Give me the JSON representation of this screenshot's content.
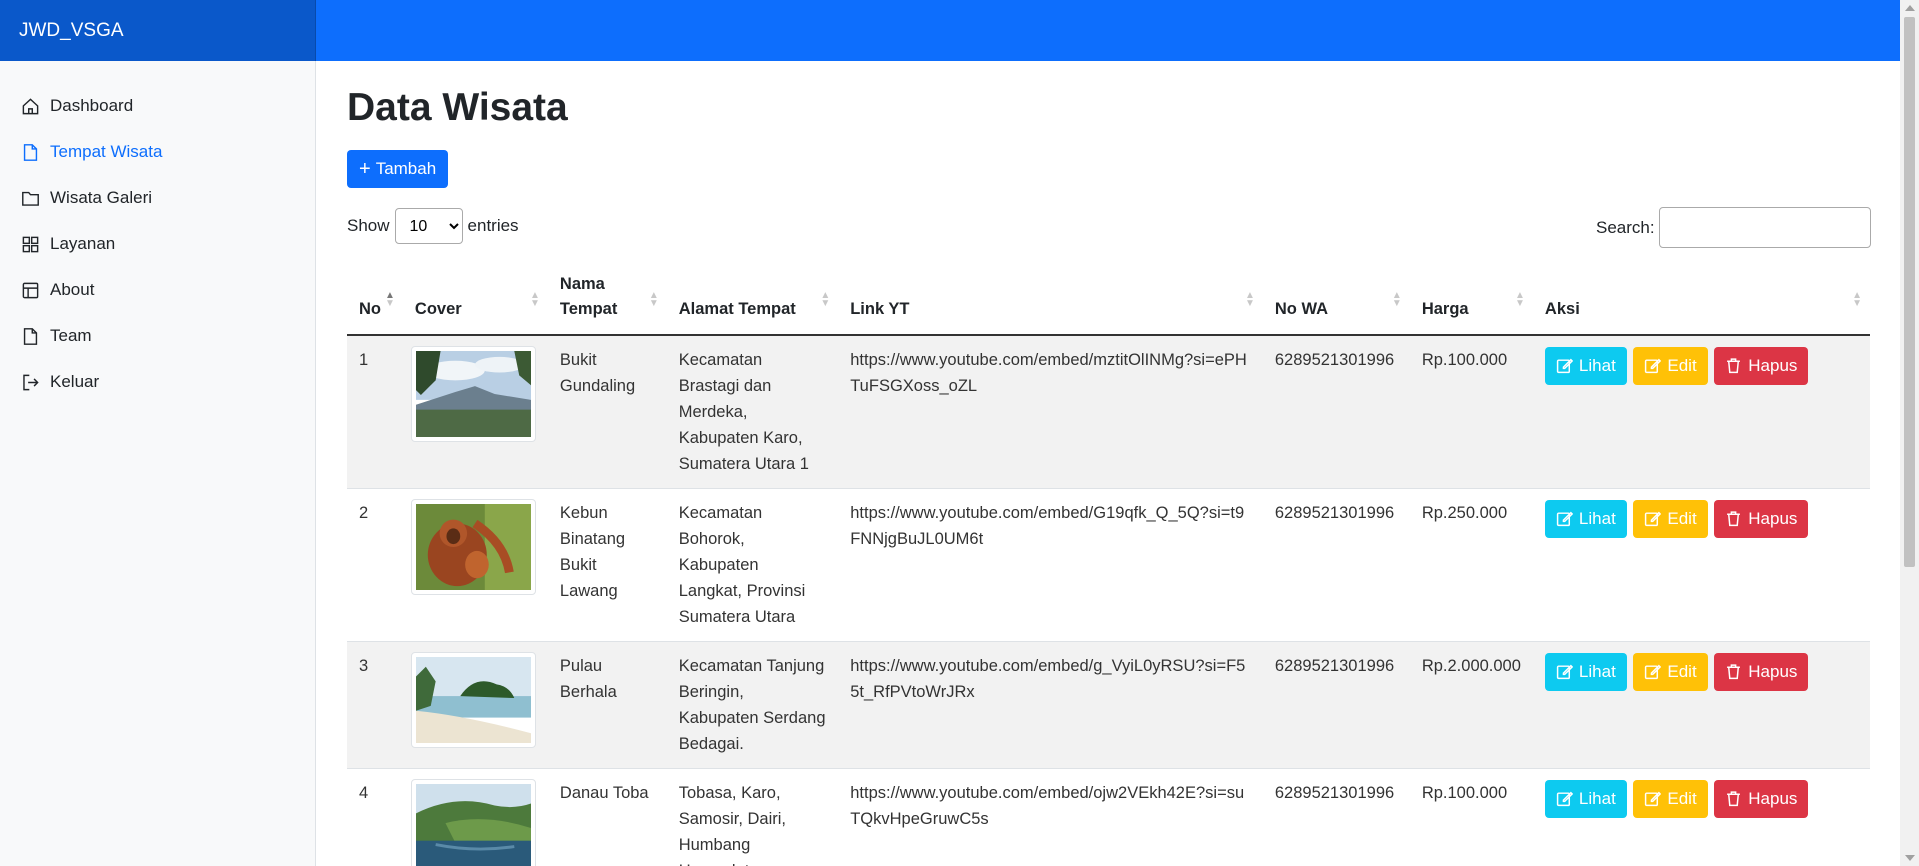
{
  "brand": "JWD_VSGA",
  "sidebar": {
    "items": [
      {
        "label": "Dashboard",
        "icon": "house-icon"
      },
      {
        "label": "Tempat Wisata",
        "icon": "file-icon"
      },
      {
        "label": "Wisata Galeri",
        "icon": "folder-icon"
      },
      {
        "label": "Layanan",
        "icon": "grid-icon"
      },
      {
        "label": "About",
        "icon": "layout-icon"
      },
      {
        "label": "Team",
        "icon": "file-icon"
      },
      {
        "label": "Keluar",
        "icon": "logout-icon"
      }
    ],
    "active_index": 1
  },
  "main": {
    "title": "Data Wisata",
    "add_label": "Tambah",
    "show_label": "Show",
    "entries_label": "entries",
    "page_size": "10",
    "search_label": "Search:",
    "search_value": ""
  },
  "table": {
    "headers": [
      "No",
      "Cover",
      "Nama Tempat",
      "Alamat Tempat",
      "Link YT",
      "No WA",
      "Harga",
      "Aksi"
    ],
    "actions": {
      "view": "Lihat",
      "edit": "Edit",
      "delete": "Hapus"
    },
    "rows": [
      {
        "no": "1",
        "nama": "Bukit Gundaling",
        "alamat": "Kecamatan Brastagi dan Merdeka, Kabupaten Karo, Sumatera Utara 1",
        "link": "https://www.youtube.com/embed/mztitOlINMg?si=ePHTuFSGXoss_oZL",
        "wa": "6289521301996",
        "harga": "Rp.100.000",
        "cover": "mountain-landscape"
      },
      {
        "no": "2",
        "nama": "Kebun Binatang Bukit Lawang",
        "alamat": "Kecamatan Bohorok, Kabupaten Langkat, Provinsi Sumatera Utara",
        "link": "https://www.youtube.com/embed/G19qfk_Q_5Q?si=t9FNNjgBuJL0UM6t",
        "wa": "6289521301996",
        "harga": "Rp.250.000",
        "cover": "orangutan"
      },
      {
        "no": "3",
        "nama": "Pulau Berhala",
        "alamat": "Kecamatan Tanjung Beringin, Kabupaten Serdang Bedagai.",
        "link": "https://www.youtube.com/embed/g_VyiL0yRSU?si=F55t_RfPVtoWrJRx",
        "wa": "6289521301996",
        "harga": "Rp.2.000.000",
        "cover": "beach-island"
      },
      {
        "no": "4",
        "nama": "Danau Toba",
        "alamat": "Tobasa, Karo, Samosir, Dairi, Humbang Hasundutan.",
        "link": "https://www.youtube.com/embed/ojw2VEkh42E?si=suTQkvHpeGruwC5s",
        "wa": "6289521301996",
        "harga": "Rp.100.000",
        "cover": "lake-hills"
      }
    ]
  },
  "colors": {
    "primary": "#0d6efd",
    "info": "#0dcaf0",
    "warning": "#ffc107",
    "danger": "#dc3545"
  }
}
